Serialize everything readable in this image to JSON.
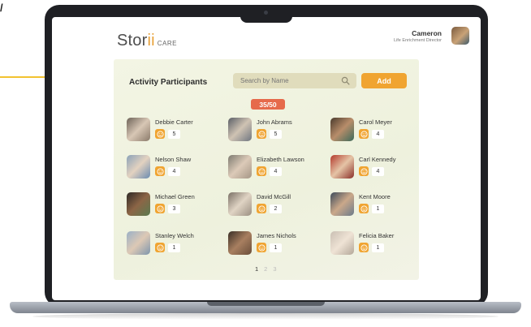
{
  "app": {
    "brand_name_a": "Stor",
    "brand_name_b": "ii",
    "brand_sub": "CARE",
    "user": {
      "name": "Cameron",
      "role": "Life Enrichment Director"
    }
  },
  "panel": {
    "title": "Activity Participants",
    "search_placeholder": "Search by Name",
    "add_label": "Add",
    "count": "35/50"
  },
  "participants": [
    {
      "name": "Debbie Carter",
      "score": "5"
    },
    {
      "name": "John Abrams",
      "score": "5"
    },
    {
      "name": "Carol Meyer",
      "score": "4"
    },
    {
      "name": "Nelson Shaw",
      "score": "4"
    },
    {
      "name": "Elizabeth Lawson",
      "score": "4"
    },
    {
      "name": "Carl Kennedy",
      "score": "4"
    },
    {
      "name": "Michael Green",
      "score": "3"
    },
    {
      "name": "David McGill",
      "score": "2"
    },
    {
      "name": "Kent Moore",
      "score": "1"
    },
    {
      "name": "Stanley Welch",
      "score": "1"
    },
    {
      "name": "James Nichols",
      "score": "1"
    },
    {
      "name": "Felicia Baker",
      "score": "1"
    }
  ],
  "pagination": {
    "pages": [
      "1",
      "2",
      "3"
    ],
    "current": "1"
  },
  "colors": {
    "accent": "#f0a431",
    "badge": "#e66a4b",
    "panel": "#f1f3e2",
    "highlight": "#f2c230"
  },
  "icons": {
    "search": "search-icon",
    "score": "smiley-face-icon"
  }
}
